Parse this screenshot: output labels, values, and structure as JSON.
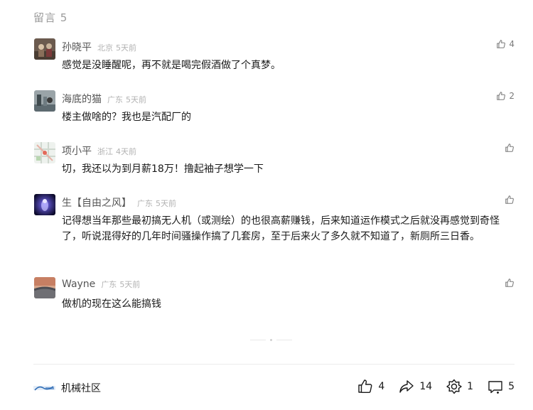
{
  "section": {
    "title": "留言 5"
  },
  "comments": [
    {
      "name": "孙晓平",
      "location": "北京",
      "time": "5天前",
      "text": "感觉是没睡醒呢，再不就是喝完假酒做了个真梦。",
      "likes": "4"
    },
    {
      "name": "海底的猫",
      "location": "广东",
      "time": "5天前",
      "text": "楼主做啥的？我也是汽配厂的",
      "likes": "2"
    },
    {
      "name": "项小平",
      "location": "浙江",
      "time": "4天前",
      "text": "切，我还以为到月薪18万！撸起袖子想学一下",
      "likes": ""
    },
    {
      "name": "生【自由之风】",
      "location": "广东",
      "time": "5天前",
      "text": "记得想当年那些最初搞无人机（或测绘）的也很高薪赚钱，后来知道运作模式之后就没再感觉到奇怪了，听说混得好的几年时间骚操作搞了几套房，至于后来火了多久就不知道了，新厕所三日香。",
      "likes": ""
    },
    {
      "name": "Wayne",
      "location": "广东",
      "time": "5天前",
      "text": "做机的现在这么能搞钱",
      "likes": ""
    }
  ],
  "footer": {
    "brand": "机械社区",
    "like_count": "4",
    "share_count": "14",
    "recommend_count": "1",
    "comment_count": "5"
  },
  "icons": {
    "comment_like": "thumbs-up-icon",
    "footer_like": "thumbs-up-icon",
    "footer_share": "share-arrow-icon",
    "footer_recommend": "flower-icon",
    "footer_comment": "comment-bubble-icon"
  }
}
